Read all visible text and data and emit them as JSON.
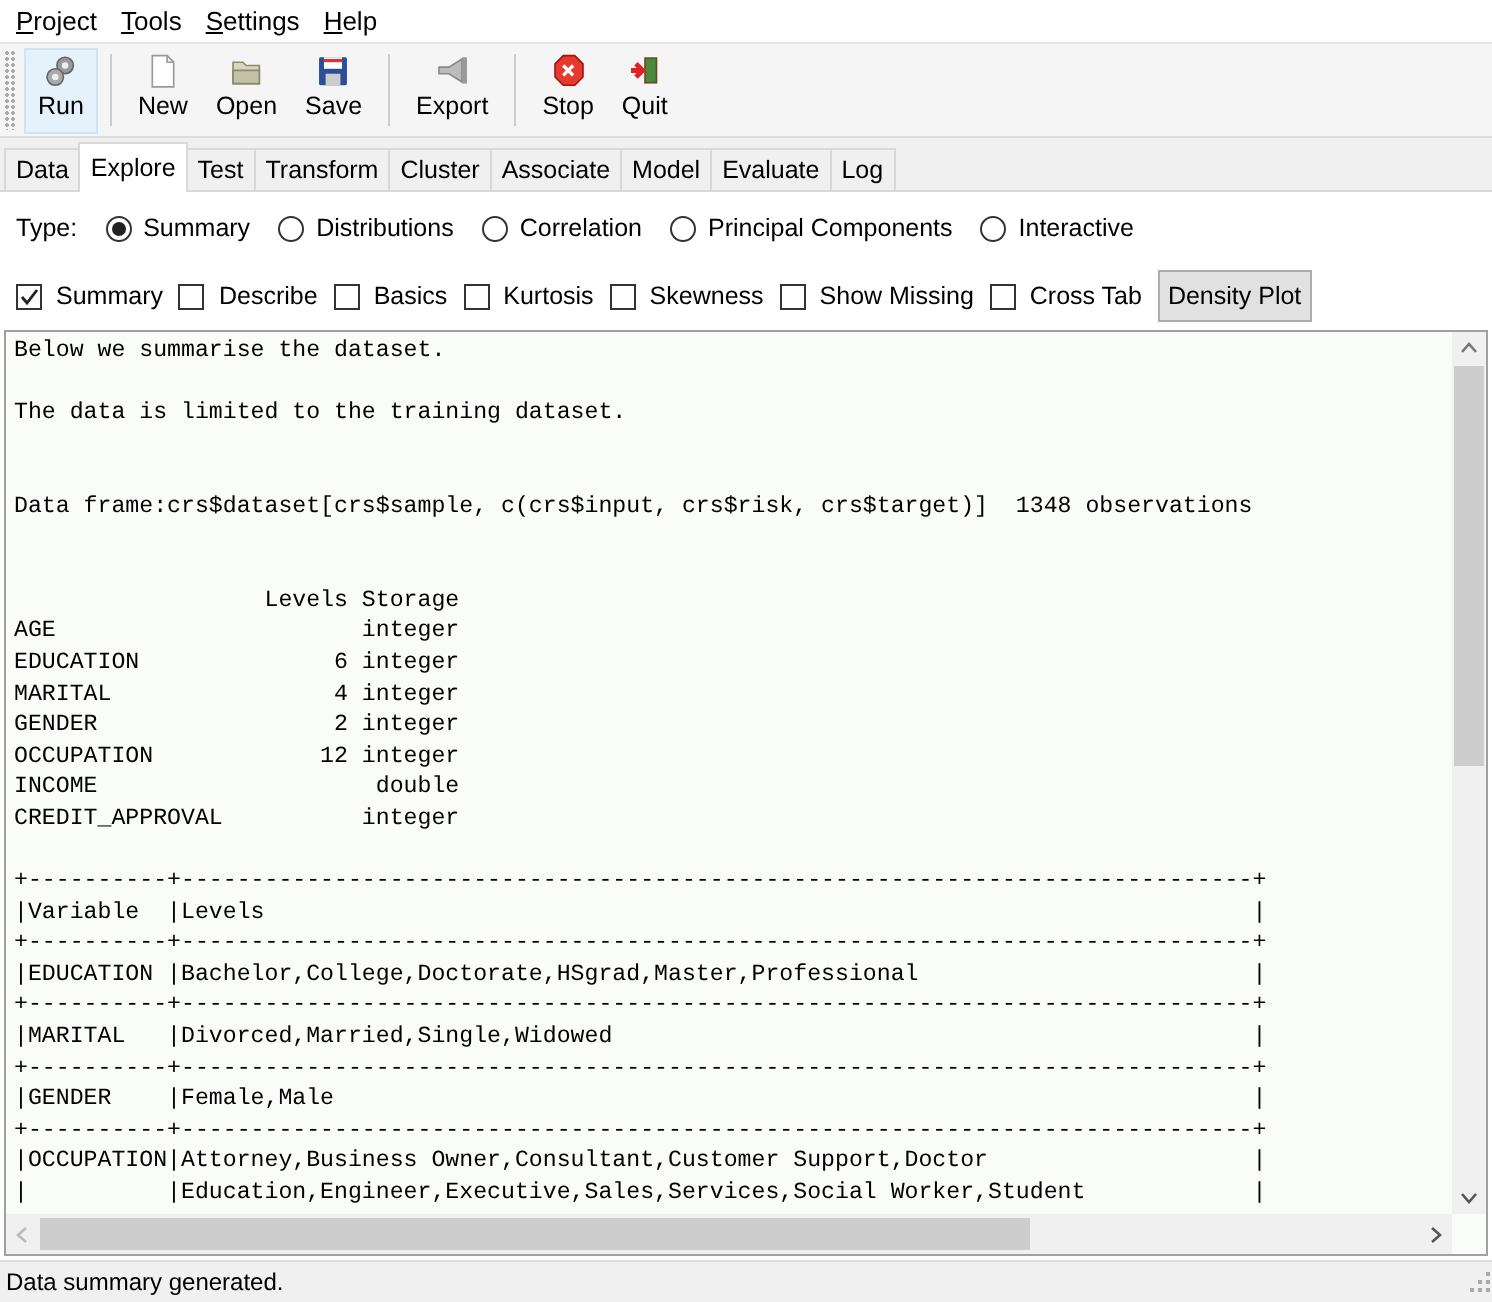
{
  "menu": [
    {
      "label": "Project"
    },
    {
      "label": "Tools"
    },
    {
      "label": "Settings"
    },
    {
      "label": "Help"
    }
  ],
  "toolbar": {
    "groups": [
      [
        {
          "label": "Run",
          "kind": "run",
          "highlighted": true
        }
      ],
      [
        {
          "label": "New",
          "kind": "new",
          "highlighted": false
        },
        {
          "label": "Open",
          "kind": "open",
          "highlighted": false
        },
        {
          "label": "Save",
          "kind": "save",
          "highlighted": false
        }
      ],
      [
        {
          "label": "Export",
          "kind": "export",
          "highlighted": false
        }
      ],
      [
        {
          "label": "Stop",
          "kind": "stop",
          "highlighted": false
        },
        {
          "label": "Quit",
          "kind": "quit",
          "highlighted": false
        }
      ]
    ]
  },
  "tabs": [
    {
      "label": "Data",
      "selected": false
    },
    {
      "label": "Explore",
      "selected": true
    },
    {
      "label": "Test",
      "selected": false
    },
    {
      "label": "Transform",
      "selected": false
    },
    {
      "label": "Cluster",
      "selected": false
    },
    {
      "label": "Associate",
      "selected": false
    },
    {
      "label": "Model",
      "selected": false
    },
    {
      "label": "Evaluate",
      "selected": false
    },
    {
      "label": "Log",
      "selected": false
    }
  ],
  "type_label": "Type:",
  "types": [
    {
      "label": "Summary",
      "selected": true
    },
    {
      "label": "Distributions",
      "selected": false
    },
    {
      "label": "Correlation",
      "selected": false
    },
    {
      "label": "Principal Components",
      "selected": false
    },
    {
      "label": "Interactive",
      "selected": false
    }
  ],
  "options": [
    {
      "label": "Summary",
      "kind": "checkbox",
      "checked": true
    },
    {
      "label": "Describe",
      "kind": "checkbox",
      "checked": false
    },
    {
      "label": "Basics",
      "kind": "checkbox",
      "checked": false
    },
    {
      "label": "Kurtosis",
      "kind": "checkbox",
      "checked": false
    },
    {
      "label": "Skewness",
      "kind": "checkbox",
      "checked": false
    },
    {
      "label": "Show Missing",
      "kind": "checkbox",
      "checked": false
    },
    {
      "label": "Cross Tab",
      "kind": "checkbox",
      "checked": false
    },
    {
      "label": "Density Plot",
      "kind": "button"
    }
  ],
  "output": {
    "blocks": [
      {
        "kind": "first",
        "lines": [
          "Below we summarise the dataset."
        ]
      },
      {
        "kind": "paragraph",
        "lines": [
          "The data is limited to the training dataset."
        ]
      },
      {
        "kind": "section",
        "lines": [
          "Data frame:crs$dataset[crs$sample, c(crs$input, crs$risk, crs$target)]  1348 observations"
        ]
      },
      {
        "kind": "section",
        "lines": [
          "                  Levels Storage",
          "AGE                      integer",
          "EDUCATION              6 integer",
          "MARITAL                4 integer",
          "GENDER                 2 integer",
          "OCCUPATION            12 integer",
          "INCOME                    double",
          "CREDIT_APPROVAL          integer"
        ]
      },
      {
        "kind": "paragraph",
        "lines": [
          "+----------+-----------------------------------------------------------------------------+",
          "|Variable  |Levels                                                                       |",
          "+----------+-----------------------------------------------------------------------------+",
          "|EDUCATION |Bachelor,College,Doctorate,HSgrad,Master,Professional                        |",
          "+----------+-----------------------------------------------------------------------------+",
          "|MARITAL   |Divorced,Married,Single,Widowed                                              |",
          "+----------+-----------------------------------------------------------------------------+",
          "|GENDER    |Female,Male                                                                  |",
          "+----------+-----------------------------------------------------------------------------+",
          "|OCCUPATION|Attorney,Business Owner,Consultant,Customer Support,Doctor                   |",
          "|          |Education,Engineer,Executive,Sales,Services,Social Worker,Student            |"
        ]
      }
    ]
  },
  "status_bar": "Data summary generated."
}
